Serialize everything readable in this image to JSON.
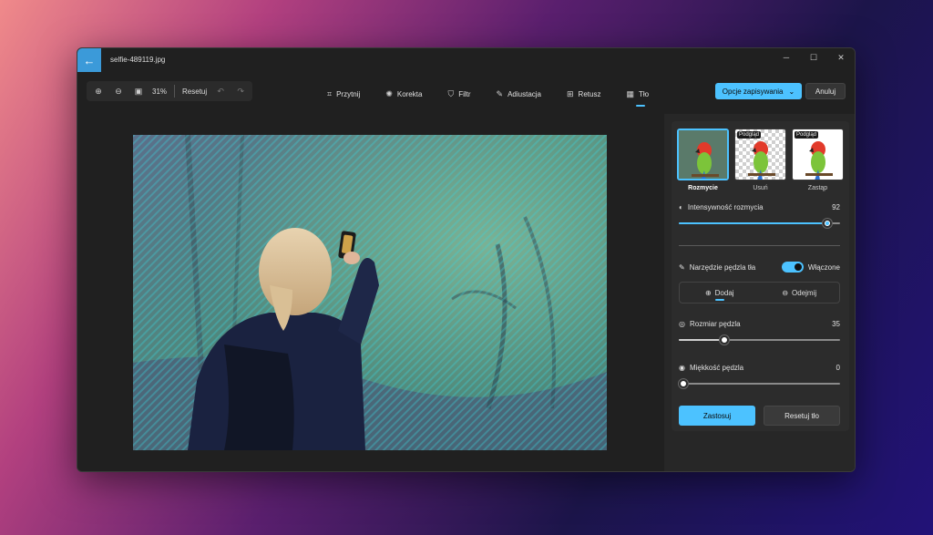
{
  "window": {
    "title": "selfie-489119.jpg",
    "back_icon": "←",
    "controls": [
      "─",
      "☐",
      "✕"
    ]
  },
  "zoom": {
    "level": "31%",
    "reset_label": "Resetuj"
  },
  "tools": [
    {
      "label": "Przytnij",
      "icon": "⌗"
    },
    {
      "label": "Korekta",
      "icon": "✺"
    },
    {
      "label": "Filtr",
      "icon": "⛉"
    },
    {
      "label": "Adiustacja",
      "icon": "✎"
    },
    {
      "label": "Retusz",
      "icon": "⊞"
    },
    {
      "label": "Tło",
      "icon": "▦"
    }
  ],
  "actions": {
    "save_label": "Opcje zapisywania",
    "cancel_label": "Anuluj"
  },
  "panel": {
    "modes": [
      {
        "label": "Rozmycie",
        "badge": ""
      },
      {
        "label": "Usuń",
        "badge": "Podgląd"
      },
      {
        "label": "Zastąp",
        "badge": "Podgląd"
      }
    ],
    "blur_intensity": {
      "label": "Intensywność rozmycia",
      "value": "92",
      "level": 0.92
    },
    "brush_tool": {
      "label": "Narzędzie pędzla tła",
      "toggle_label": "Włączone"
    },
    "segment": {
      "add": "Dodaj",
      "subtract": "Odejmij"
    },
    "brush_size": {
      "label": "Rozmiar pędzla",
      "value": "35",
      "level": 0.28
    },
    "brush_softness": {
      "label": "Miękkość pędzla",
      "value": "0",
      "level": 0
    },
    "apply_label": "Zastosuj",
    "reset_bg_label": "Resetuj tło"
  },
  "colors": {
    "accent": "#4cc2ff",
    "window_bg": "#202020",
    "panel_bg": "#272727"
  }
}
